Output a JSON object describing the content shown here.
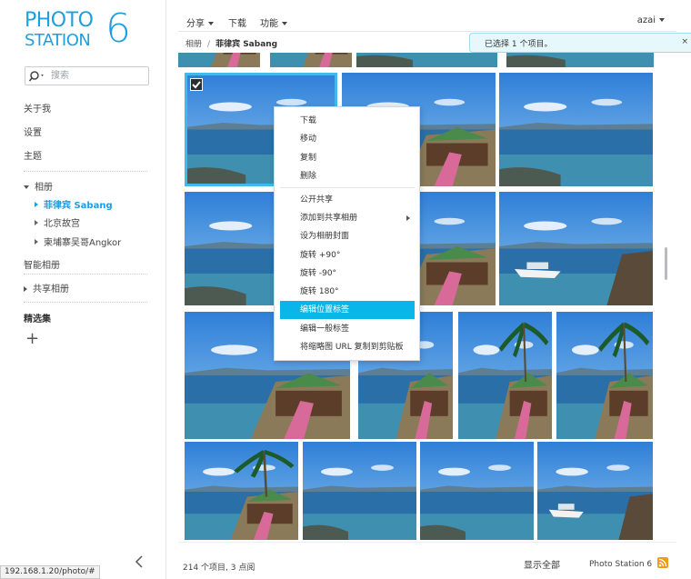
{
  "logo": {
    "line1": "PHOTO",
    "line2": "STATION",
    "version": "6"
  },
  "search": {
    "placeholder": "搜索"
  },
  "sidebar": {
    "about": "关于我",
    "settings": "设置",
    "theme": "主题",
    "albums": "相册",
    "album_items": [
      "菲律宾 Sabang",
      "北京故宫",
      "柬埔寨吴哥Angkor"
    ],
    "smart_album": "智能相册",
    "shared_album": "共享相册",
    "featured": "精选集",
    "add": "+"
  },
  "toolbar": {
    "share": "分享",
    "download": "下载",
    "features": "功能",
    "user": "azai"
  },
  "breadcrumb": {
    "root": "相册",
    "separator": "/",
    "current": "菲律宾 Sabang"
  },
  "toast": {
    "message": "已选择 1 个项目。",
    "close": "×"
  },
  "context_menu": {
    "items": [
      "下载",
      "移动",
      "复制",
      "删除",
      "公开共享",
      "添加到共享相册",
      "设为相册封面",
      "旋转 +90°",
      "旋转 -90°",
      "旋转 180°",
      "编辑位置标签",
      "编辑一般标签",
      "将缩略图 URL 复制到剪贴板"
    ],
    "highlighted": "编辑位置标签"
  },
  "footer": {
    "count": "214 个项目, 3 点阅",
    "show_all": "显示全部",
    "brand": "Photo Station 6"
  },
  "status_url": "192.168.1.20/photo/#",
  "colors": {
    "accent": "#1e9fe0",
    "highlight": "#0ab6e9",
    "selection": "#41b9ea",
    "toast_bg": "#e6f8fb"
  }
}
